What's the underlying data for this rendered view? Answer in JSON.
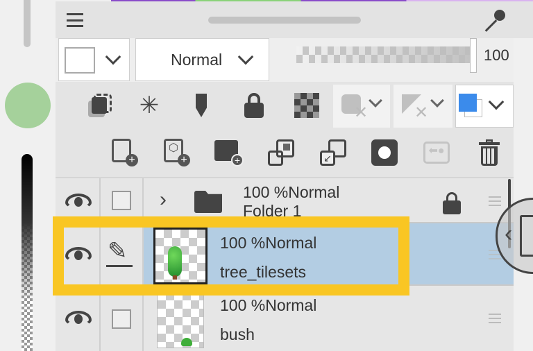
{
  "toolbar": {
    "blend_mode": "Normal",
    "opacity_value": "100",
    "opacity_percent": 100
  },
  "icons_row1": [
    "layer-clip-icon",
    "reference-layer-icon",
    "draft-layer-icon",
    "lock-icon",
    "lock-transparency-icon",
    "mask-disabled-icon",
    "ruler-disabled-icon",
    "layer-color-icon"
  ],
  "icons_row2": [
    "new-raster-layer-icon",
    "new-vector-layer-icon",
    "new-folder-icon",
    "transfer-down-icon",
    "merge-down-icon",
    "layer-mask-icon",
    "apply-mask-icon",
    "delete-icon"
  ],
  "layers": [
    {
      "opacity_mode": "100 %Normal",
      "name": "Folder 1",
      "type": "folder",
      "locked": true,
      "visible": true
    },
    {
      "opacity_mode": "100 %Normal",
      "name": "tree_tilesets",
      "type": "raster",
      "selected": true,
      "visible": true
    },
    {
      "opacity_mode": "100 %Normal",
      "name": "bush",
      "type": "raster",
      "visible": true
    }
  ],
  "colors": {
    "selected_row": "#b3cde3",
    "highlight": "#f9c623",
    "main_color": "#3b8beb",
    "left_color_swatch": "#a5d19b"
  }
}
